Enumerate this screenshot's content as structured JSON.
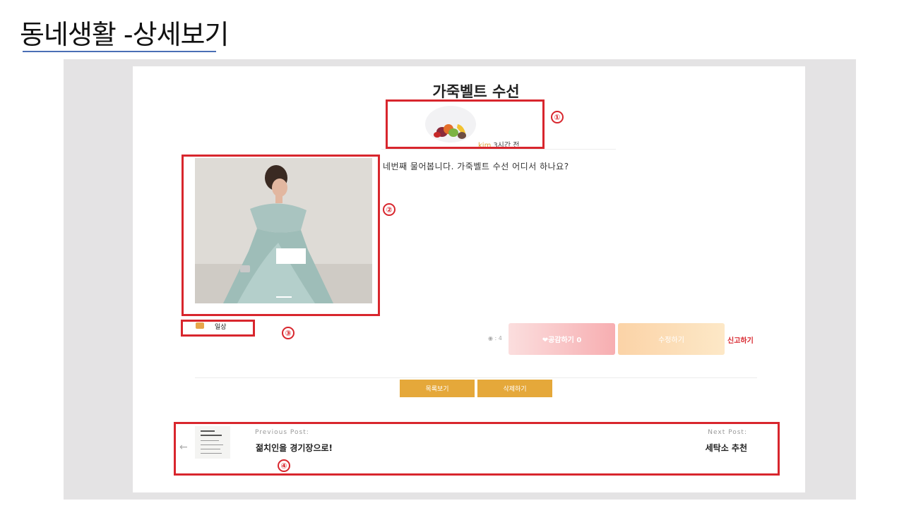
{
  "slide": {
    "title": "동네생활 -상세보기"
  },
  "post": {
    "title": "가죽벨트 수선",
    "author": "kim",
    "time": "3시간 전",
    "body": "네번째 물어봅니다. 가죽벨트 수선 어디서 하나요?",
    "tag": "일상",
    "views": "◉ : 4"
  },
  "actions": {
    "like_label": "❤공감하기 0",
    "edit_label": "수정하기",
    "report_label": "신고하기",
    "list_label": "목록보기",
    "delete_label": "삭제하기"
  },
  "navigation": {
    "prev_kicker": "Previous Post:",
    "prev_title": "젊치인을 경기장으로!",
    "next_kicker": "Next Post:",
    "next_title": "세탁소 추천",
    "prev_arrow": "←"
  },
  "annotations": [
    "①",
    "②",
    "③",
    "④"
  ],
  "colors": {
    "highlight": "#d8262d",
    "accent": "#e5a83a",
    "author": "#e0a23a"
  }
}
